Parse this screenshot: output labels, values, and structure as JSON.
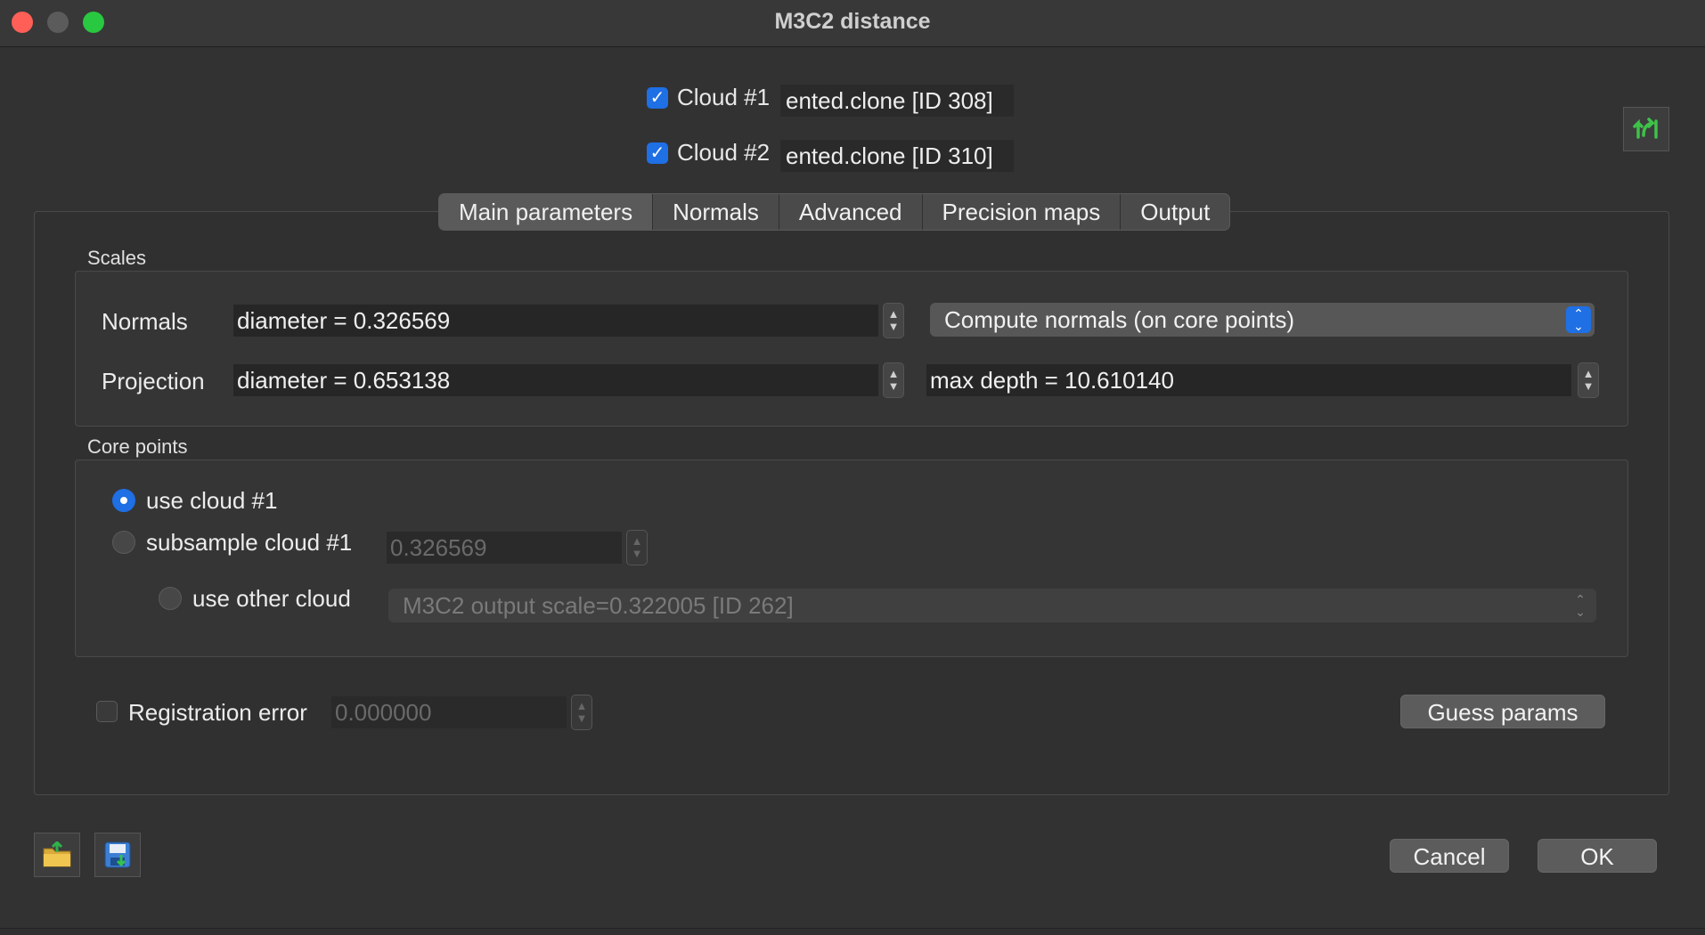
{
  "window": {
    "title": "M3C2 distance"
  },
  "clouds": [
    {
      "label": "Cloud #1",
      "name": "ented.clone [ID 308]",
      "checked": true
    },
    {
      "label": "Cloud #2",
      "name": "ented.clone [ID 310]",
      "checked": true
    }
  ],
  "tabs": [
    {
      "label": "Main parameters",
      "active": true
    },
    {
      "label": "Normals"
    },
    {
      "label": "Advanced"
    },
    {
      "label": "Precision maps"
    },
    {
      "label": "Output"
    }
  ],
  "scales": {
    "title": "Scales",
    "normals_label": "Normals",
    "normals_value": "diameter = 0.326569",
    "normals_mode": "Compute normals (on core points)",
    "projection_label": "Projection",
    "projection_value": "diameter = 0.653138",
    "max_depth_value": "max depth = 10.610140"
  },
  "core_points": {
    "title": "Core points",
    "use_cloud1_label": "use cloud #1",
    "subsample_label": "subsample cloud #1",
    "subsample_value": "0.326569",
    "use_other_label": "use other cloud",
    "other_cloud_value": "M3C2 output scale=0.322005 [ID 262]"
  },
  "registration": {
    "label": "Registration error",
    "value": "0.000000"
  },
  "buttons": {
    "guess": "Guess params",
    "cancel": "Cancel",
    "ok": "OK"
  },
  "icons": {
    "swap": "swap-clouds-icon",
    "load": "load-params-icon",
    "save": "save-params-icon"
  }
}
